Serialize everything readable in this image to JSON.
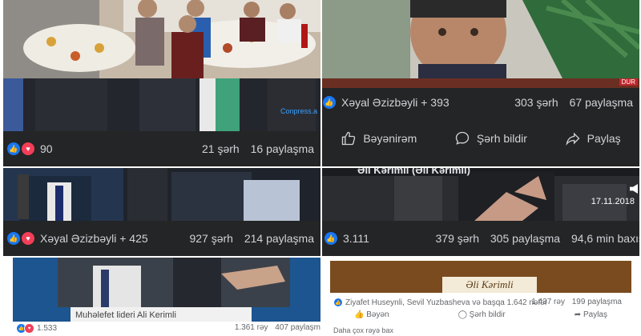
{
  "posts": [
    {
      "reaction_count": "90",
      "comments": "21 şərh",
      "shares": "16 paylaşma",
      "watermark": "Conpress.a"
    },
    {
      "reaction_names": "Xəyal Əzizbəyli + 393",
      "comments": "303 şərh",
      "shares": "67 paylaşma",
      "badge": "DUR",
      "actions": {
        "like": "Bəyənirəm",
        "comment": "Şərh bildir",
        "share": "Paylaş"
      }
    },
    {
      "reaction_names": "Xəyal Əzizbəyli + 425",
      "comments": "927 şərh",
      "shares": "214 paylaşma"
    },
    {
      "reaction_count": "3.111",
      "comments": "379 şərh",
      "shares": "305 paylaşma",
      "views": "94,6 min baxış",
      "date_stamp": "17.11.2018",
      "page_name": "Əli Kərimli (Əli Kərimli)"
    },
    {
      "caption": "Muhəlefet lideri Ali Kerimli",
      "reaction_count": "1.533",
      "comments": "1.361 rəy",
      "shares": "407 paylaşm"
    },
    {
      "banner_title": "Əli Kərimli",
      "reaction_names": "Ziyafet Huseynli, Sevil Yuzbasheva və başqa 1.642 nəfər",
      "comments": "1.437 rəy",
      "shares": "199 paylaşma",
      "actions": {
        "like": "Bəyən",
        "comment": "Şərh bildir",
        "share": "Paylaş"
      },
      "more": "Daha çox rəyə bax"
    }
  ],
  "colors": {
    "facebook_blue": "#1877f2",
    "love_red": "#f33e58",
    "dark_bar": "#242526"
  }
}
